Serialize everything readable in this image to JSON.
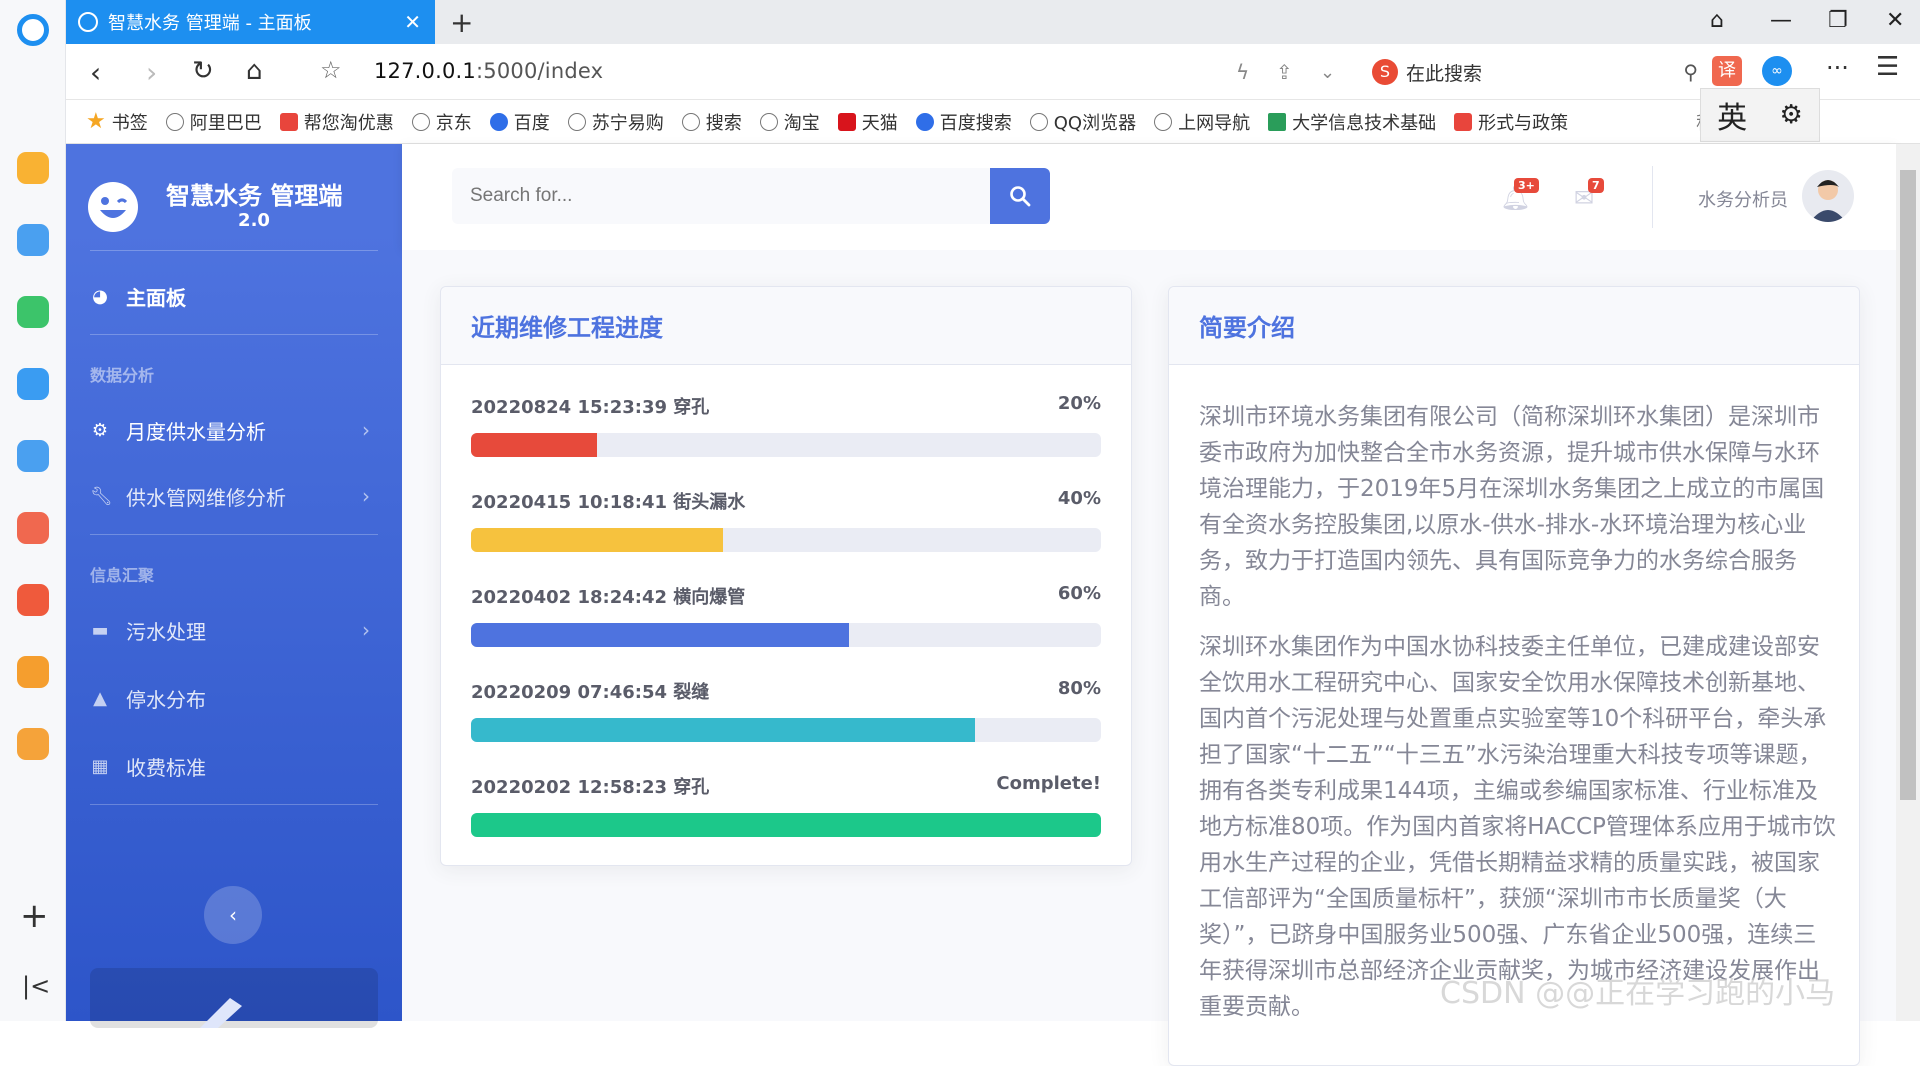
{
  "browser": {
    "tab_title": "智慧水务 管理端 - 主面板",
    "url_host": "127.0.0.1",
    "url_rest": ":5000/index",
    "search_engine_label": "在此搜索",
    "ime_label": "英"
  },
  "bookmarks": [
    "书签",
    "阿里巴巴",
    "帮您淘优惠",
    "京东",
    "百度",
    "苏宁易购",
    "搜索",
    "淘宝",
    "天猫",
    "百度搜索",
    "QQ浏览器",
    "上网导航",
    "大学信息技术基础",
    "形式与政策",
    "程序"
  ],
  "sidebar": {
    "brand_title": "智慧水务 管理端",
    "brand_version": "2.0",
    "dashboard": "主面板",
    "heading_analysis": "数据分析",
    "item_monthly": "月度供水量分析",
    "item_pipe": "供水管网维修分析",
    "heading_info": "信息汇聚",
    "item_sewage": "污水处理",
    "item_outage": "停水分布",
    "item_fees": "收费标准"
  },
  "topbar": {
    "search_placeholder": "Search for...",
    "alerts_count": "3+",
    "messages_count": "7",
    "user_name": "水务分析员"
  },
  "progress_card": {
    "title": "近期维修工程进度",
    "items": [
      {
        "label": "20220824 15:23:39 穿孔",
        "pct_text": "20%",
        "value": 0.2,
        "color": "#e74a3b"
      },
      {
        "label": "20220415 10:18:41 街头漏水",
        "pct_text": "40%",
        "value": 0.4,
        "color": "#f6c23e"
      },
      {
        "label": "20220402 18:24:42 横向爆管",
        "pct_text": "60%",
        "value": 0.6,
        "color": "#4e73df"
      },
      {
        "label": "20220209 07:46:54 裂缝",
        "pct_text": "80%",
        "value": 0.8,
        "color": "#36b9cc"
      },
      {
        "label": "20220202 12:58:23 穿孔",
        "pct_text": "Complete!",
        "value": 1.0,
        "color": "#1cc88a"
      }
    ]
  },
  "intro_card": {
    "title": "简要介绍",
    "para1": "深圳市环境水务集团有限公司（简称深圳环水集团）是深圳市委市政府为加快整合全市水务资源，提升城市供水保障与水环境治理能力，于2019年5月在深圳水务集团之上成立的市属国有全资水务控股集团,以原水-供水-排水-水环境治理为核心业务，致力于打造国内领先、具有国际竞争力的水务综合服务商。",
    "para2": "深圳环水集团作为中国水协科技委主任单位，已建成建设部安全饮用水工程研究中心、国家安全饮用水保障技术创新基地、国内首个污泥处理与处置重点实验室等10个科研平台，牵头承担了国家“十二五”“十三五”水污染治理重大科技专项等课题，拥有各类专利成果144项，主编或参编国家标准、行业标准及地方标准80项。作为国内首家将HACCP管理体系应用于城市饮用水生产过程的企业，凭借长期精益求精的质量实践，被国家工信部评为“全国质量标杆”，获颁“深圳市市长质量奖（大奖）”，已跻身中国服务业500强、广东省企业500强，连续三年获得深圳市总部经济企业贡献奖，为城市经济建设发展作出重要贡献。"
  },
  "watermark": "CSDN @@正在学习跑的小马"
}
